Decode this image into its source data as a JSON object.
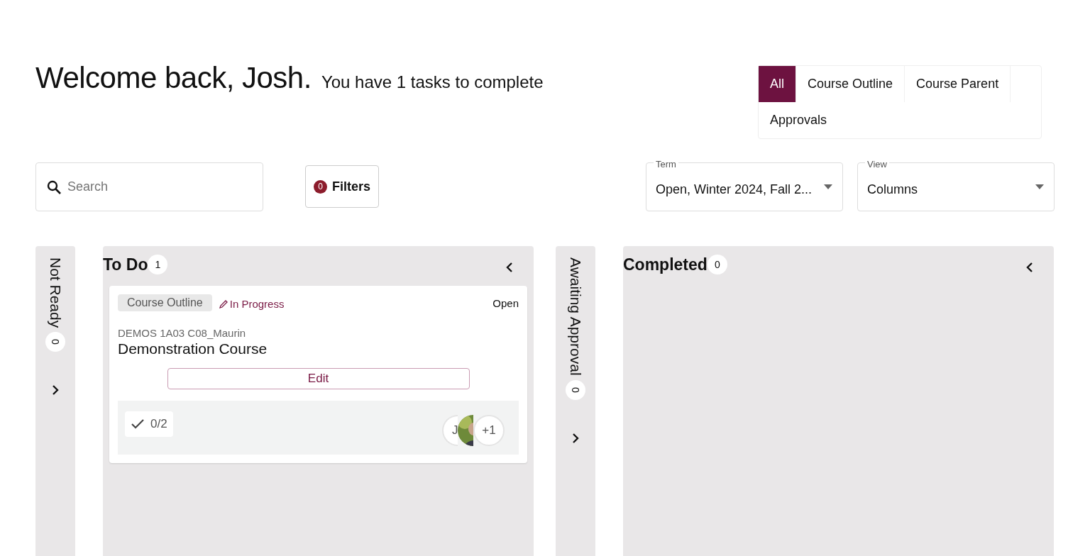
{
  "header": {
    "greeting": "Welcome back, Josh.",
    "subtitle": "You have 1 tasks to complete"
  },
  "tabs": [
    {
      "label": "All",
      "selected": true
    },
    {
      "label": "Course Outline",
      "selected": false
    },
    {
      "label": "Course Parent",
      "selected": false
    },
    {
      "label": "Approvals",
      "selected": false
    }
  ],
  "search": {
    "placeholder": "Search"
  },
  "filters": {
    "count": "0",
    "label": "Filters"
  },
  "selects": [
    {
      "label": "Term",
      "value": "Open, Winter 2024, Fall 2..."
    },
    {
      "label": "View",
      "value": "Columns"
    }
  ],
  "columns": [
    {
      "title": "Not Ready",
      "count": "0",
      "expanded": false
    },
    {
      "title": "To Do",
      "count": "1",
      "expanded": true,
      "cards": [
        {
          "tag": "Course Outline",
          "status": "In Progress",
          "term": "Open",
          "code": "DEMOS 1A03 C08_Maurin",
          "title": "Demonstration Course",
          "action": "Edit",
          "checklist": "0/2",
          "avatars": [
            {
              "kind": "initials",
              "text": "J"
            },
            {
              "kind": "picture"
            },
            {
              "kind": "more",
              "text": "+1"
            }
          ]
        }
      ]
    },
    {
      "title": "Awaiting Approval",
      "count": "0",
      "expanded": false
    },
    {
      "title": "Completed",
      "count": "0",
      "expanded": true
    }
  ]
}
